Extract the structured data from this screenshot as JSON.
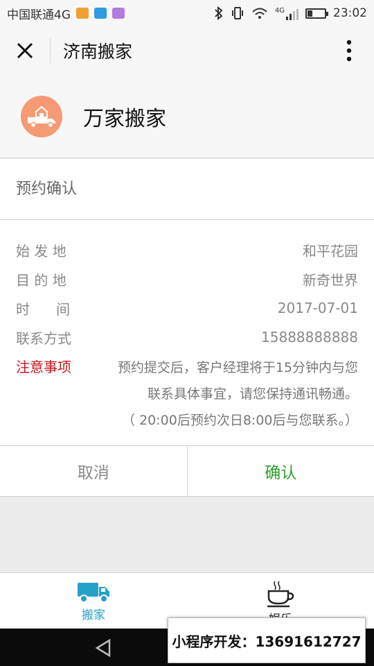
{
  "status": {
    "carrier": "中国联通4G",
    "network": "4G",
    "time": "23:02"
  },
  "titlebar": {
    "title": "济南搬家"
  },
  "company": {
    "name": "万家搬家",
    "logo_color": "#f59a74"
  },
  "confirm": {
    "section_title": "预约确认",
    "rows": [
      {
        "label": "始 发 地",
        "value": "和平花园"
      },
      {
        "label": "目 的 地",
        "value": "新奇世界"
      },
      {
        "label": "时      间",
        "value": "2017-07-01"
      },
      {
        "label": "联系方式",
        "value": "15888888888"
      }
    ],
    "note_label": "注意事项",
    "note_lines": [
      "预约提交后，客户经理将于15分钟内与您",
      "联系具体事宜，请您保持通讯畅通。",
      "（ 20:00后预约次日8:00后与您联系。）"
    ]
  },
  "actions": {
    "cancel": "取消",
    "confirm": "确认",
    "confirm_color": "#2ea02e"
  },
  "tabs": [
    {
      "label": "搬家",
      "icon": "truck-icon",
      "active": true
    },
    {
      "label": "娱乐",
      "icon": "coffee-cup-icon",
      "active": false
    }
  ],
  "watermark": {
    "text": "小程序开发：13691612727"
  }
}
